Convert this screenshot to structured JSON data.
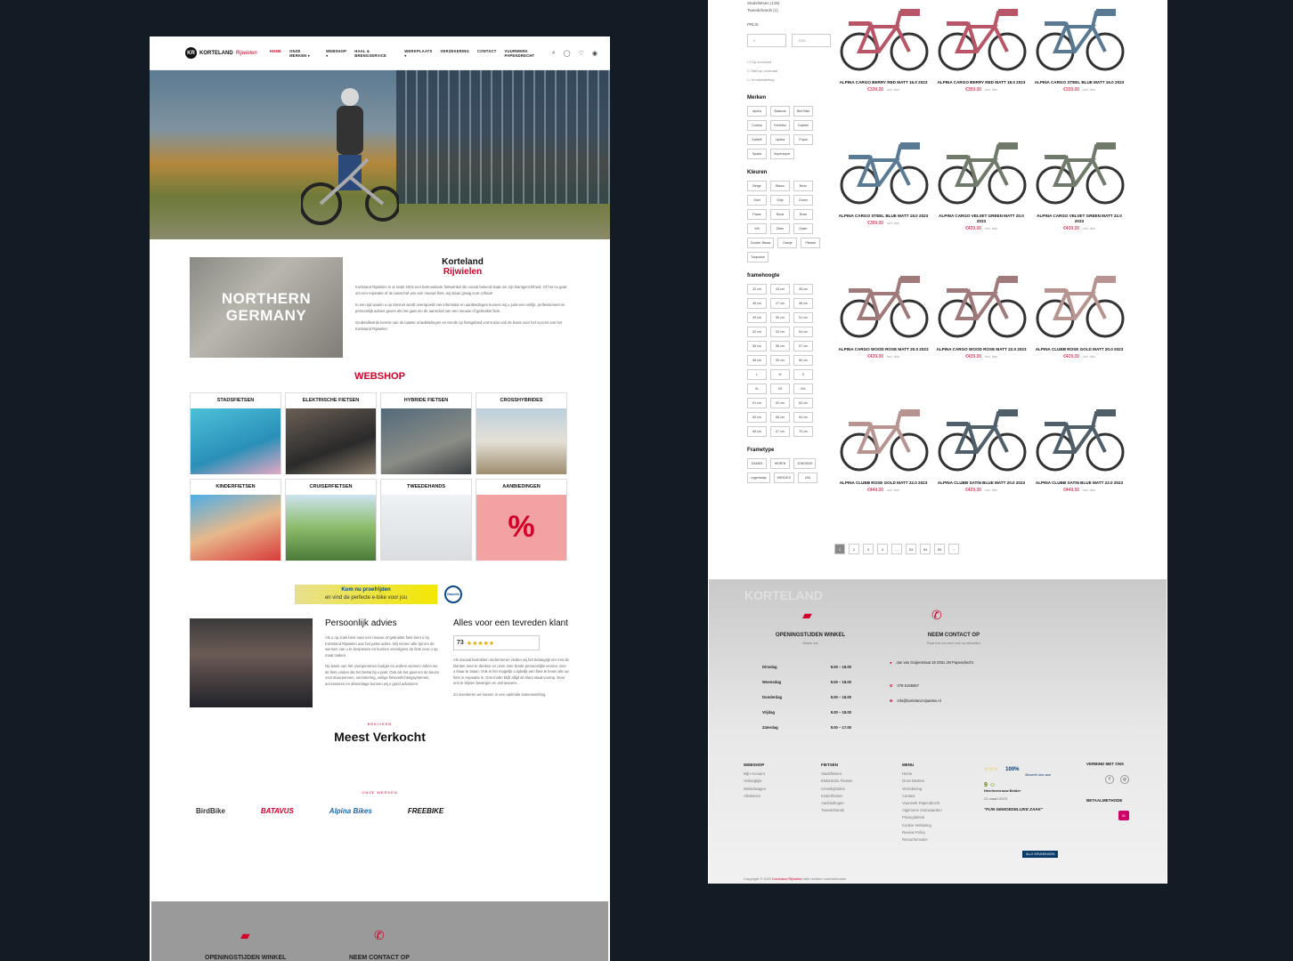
{
  "header": {
    "logo_name": "KORTELAND",
    "logo_script": "Rijwielen",
    "nav": [
      "HOME",
      "ONZE MERKEN ▾",
      "WEBSHOP ▾",
      "HAAL & BRENGSERVICE",
      "WERKPLAATS ▾",
      "VERZEKERING",
      "CONTACT",
      "VUURWERK PAPENDRECHT"
    ],
    "icons": [
      "search-icon",
      "user-icon",
      "heart-icon",
      "cart-icon"
    ]
  },
  "intro": {
    "image_text": [
      "NORTHERN",
      "GERMANY"
    ],
    "title1": "Korteland",
    "title2": "Rijwielen",
    "p1": "Korteland Rijwielen is al sinds 2002 een betrouwbare fietswinkel die vooral bekend staat om zijn klantgerichtheid. Of het nu gaat om een reparatie of de aanschaf van een nieuwe fiets, wij staan graag voor u klaar!",
    "p2": "In een tijd waarin u op internet wordt overspoeld met informatie en aanbiedingen kunnen wij u juist een eerlijk, professioneel en persoonlijk advies geven als het gaat om de aanschaf van een nieuwe of gebruikte fiets.",
    "p3": "Gedetailleerde kennis van de laatste ontwikkelingen en trends op fietsgebied vormt dan ook de basis voor het succes van het Korteland Rijwielen."
  },
  "webshop": {
    "title": "WEBSHOP",
    "tiles": [
      "STADSFIETSEN",
      "ELEKTRISCHE FIETSEN",
      "HYBRIDE FIETSEN",
      "CROSSHYBRIDES",
      "KINDERFIETSEN",
      "CRUISERFIETSEN",
      "TWEEDEHANDS",
      "AANBIEDINGEN"
    ]
  },
  "banner": {
    "line1": "Kom nu proefrijden",
    "line2": "en vind de perfecte e-bike voor jou",
    "brand": "Gazelle"
  },
  "advies": {
    "title": "Persoonlijk advies",
    "p1": "Als u op zoek bent naar een nieuwe of gebruikte fiets bent u bij Korteland Rijwielen aan het juiste adres. Wij nemen alle tijd om de wensen van u te bespreken en kunnen vervolgens de fiets voor u op maat maken.",
    "p2": "Op basis van het voorgenomen budget en andere wensen zullen we de fiets vinden die het beste bij u past. Ook als het gaat om de keuze voor stuurpennen, verzekering, veilige fietsverlichtingsystemen, accessoires en afmonitage kunnen wij u goed adviseren."
  },
  "klant": {
    "title": "Alles voor een tevreden klant",
    "score": "73",
    "stars": "★★★★★",
    "p1": "Als sociaal betrokken ondernemer vinden wij het belangrijk om met de klanten mee te denken en onze zeer brede persoonlijke service voor u klaar te staan. Ook is het mogelijk u tijdelijk een fiets te lenen als uw fiets in reparatie is. Ons motto blijft altijd de klant staat voorop. Door ons te blijven bewegen en vernieuwen...",
    "p2": "Zo investeren we samen in een optimale samenwerking."
  },
  "bekijken": "BEKIJKEN",
  "meest": "Meest Verkocht",
  "onze_merken": "ONZE MERKEN",
  "brands": [
    "BirdBike",
    "BATAVUS",
    "Alpina Bikes",
    "FREEBIKE"
  ],
  "left_footer": {
    "t1": "OPENINGSTIJDEN WINKEL",
    "t2": "NEEM CONTACT OP"
  },
  "filters": {
    "top": [
      "Stadsfietsen (139)",
      "Tweedehands (1)"
    ],
    "prijs": "PRIJS",
    "min": "0",
    "max": "1199",
    "checks": [
      "Op voorraad",
      "Niet op voorraad",
      "In nabestelling"
    ],
    "merken_title": "Merken",
    "merken": [
      "Alpina",
      "Batavus",
      "Bird Bike",
      "Cortina",
      "Freebike",
      "Gazelle",
      "Kaltloff",
      "Lipeka",
      "Popal",
      "Sparta",
      "Supersuper"
    ],
    "kleuren_title": "Kleuren",
    "kleuren": [
      "Beige",
      "Blauw",
      "Bruin",
      "Geel",
      "Grijs",
      "Groen",
      "Paars",
      "Rood",
      "Rose",
      "Wit",
      "Zilver",
      "Zwart",
      "Donker Blauw",
      "Oranje",
      "Pistach",
      "Turquoise"
    ],
    "frame_title": "framehoogte",
    "frame": [
      "32 cm",
      "43 cm",
      "45 cm",
      "46 cm",
      "47 cm",
      "48 cm",
      "49 cm",
      "50 cm",
      "51 cm",
      "52 cm",
      "53 cm",
      "54 cm",
      "55 cm",
      "56 cm",
      "57 cm",
      "58 cm",
      "59 cm",
      "60 cm",
      "L",
      "M",
      "S",
      "XL",
      "XS",
      "XXL",
      "61 cm",
      "62 cm",
      "63 cm",
      "65 cm",
      "66 cm",
      "64 cm",
      "68 cm",
      "67 cm",
      "70 cm"
    ],
    "type_title": "Frametype",
    "types": [
      "DAMES",
      "HEREN",
      "JONGENS",
      "Lageinstap",
      "MEISJES",
      "UNI"
    ]
  },
  "products": [
    {
      "name": "ALPINA CARGO BERRY RED MATT 16.0 2023",
      "price": "€339,00",
      "incl": "incl. btw",
      "color": "#b85566"
    },
    {
      "name": "ALPINA CARGO BERRY RED MATT 18.0 2023",
      "price": "€359,00",
      "incl": "incl. btw",
      "color": "#b85566"
    },
    {
      "name": "ALPINA CARGO STEEL BLUE MATT 16.0 2023",
      "price": "€339,00",
      "incl": "incl. btw",
      "color": "#5a7a93"
    },
    {
      "name": "ALPINA CARGO STEEL BLUE MATT 18.0 2023",
      "price": "€359,00",
      "incl": "incl. btw",
      "color": "#5a7a93"
    },
    {
      "name": "ALPINA CARGO VELVET GREEN MATT 20.0 2023",
      "price": "€429,00",
      "incl": "incl. btw",
      "color": "#6f7a6a"
    },
    {
      "name": "ALPINA CARGO VELVET GREEN MATT 22.0 2023",
      "price": "€439,00",
      "incl": "incl. btw",
      "color": "#6f7a6a"
    },
    {
      "name": "ALPINA CARGO WOOD ROSE MATT 20.0 2023",
      "price": "€429,00",
      "incl": "incl. btw",
      "color": "#a07a7a"
    },
    {
      "name": "ALPINA CARGO WOOD ROSE MATT 22.0 2023",
      "price": "€439,00",
      "incl": "incl. btw",
      "color": "#a07a7a"
    },
    {
      "name": "ALPINA CLUBB ROSE GOLD MATT 20.0 2023",
      "price": "€429,00",
      "incl": "incl. btw",
      "color": "#b89490"
    },
    {
      "name": "ALPINA CLUBB ROSE GOLD MATT 22.0 2023",
      "price": "€449,00",
      "incl": "incl. btw",
      "color": "#b89490"
    },
    {
      "name": "ALPINA CLUBB SATIN BLUE MATT 20.0 2023",
      "price": "€429,00",
      "incl": "incl. btw",
      "color": "#4f5f6a"
    },
    {
      "name": "ALPINA CLUBB SATIN BLUE MATT 22.0 2023",
      "price": "€449,00",
      "incl": "incl. btw",
      "color": "#4f5f6a"
    }
  ],
  "pagination": [
    "1",
    "2",
    "3",
    "4",
    "…",
    "53",
    "54",
    "55",
    "›"
  ],
  "footer": {
    "open_title": "OPENINGSTIJDEN WINKEL",
    "open_sub": "Bekiek ook",
    "hours": [
      [
        "Dinsdag",
        "9.00 – 18.00"
      ],
      [
        "Woensdag",
        "9.00 – 18.00"
      ],
      [
        "Donderdag",
        "9.00 – 18.00"
      ],
      [
        "Vrijdag",
        "9.00 – 18.00"
      ],
      [
        "Zaterdag",
        "9.00 – 17.00"
      ]
    ],
    "contact_title": "NEEM CONTACT OP",
    "contact_sub": "Praat met ons team over uw behoeften",
    "address": "Jan van Goijenstraat 19 3351 JM Papendrecht",
    "phone": "078 6155557",
    "email": "info@korteland-rijwielen.nl",
    "webshop_title": "WEBSHOP",
    "webshop_links": [
      "Mijn Account",
      "Verlanglijst",
      "Winkelwagen",
      "Afrekenen"
    ],
    "fietsen_title": "FIETSEN",
    "fietsen_links": [
      "Stadsfietsen",
      "Elektrische Fietsen",
      "Crosshybrides",
      "Kinderfietsen",
      "Aanbiedingen",
      "Tweedehands"
    ],
    "menu_title": "MENU",
    "menu_links": [
      "Home",
      "Onze Merken",
      "Verzekering",
      "Contact",
      "Vuurwerk Papendrecht",
      "Algemene Voorwaarden",
      "Privacybeleid",
      "Cookie Verklaring",
      "Review Policy",
      "Retourformulier"
    ],
    "kiyoh_pct": "100%",
    "kiyoh_beveelt": "Beveelt ons aan",
    "kiyoh_score": "9",
    "kiyoh_name": "Heer/mevrouw Belder",
    "kiyoh_date": "21 maart 2023",
    "kiyoh_quote": "\"FIJN GEMOEDELIJKE ZAAK\"",
    "kiyoh_btn": "ALLE ERVARINGEN",
    "verbind": "VERBIND MET ONS",
    "betaal": "BETAALMETHODE",
    "ideal": "iD",
    "copy1": "Copyright © 2022",
    "copy_brand": "Korteland Rijwielen",
    "copy2": "Alle rechten voorbehouden"
  }
}
